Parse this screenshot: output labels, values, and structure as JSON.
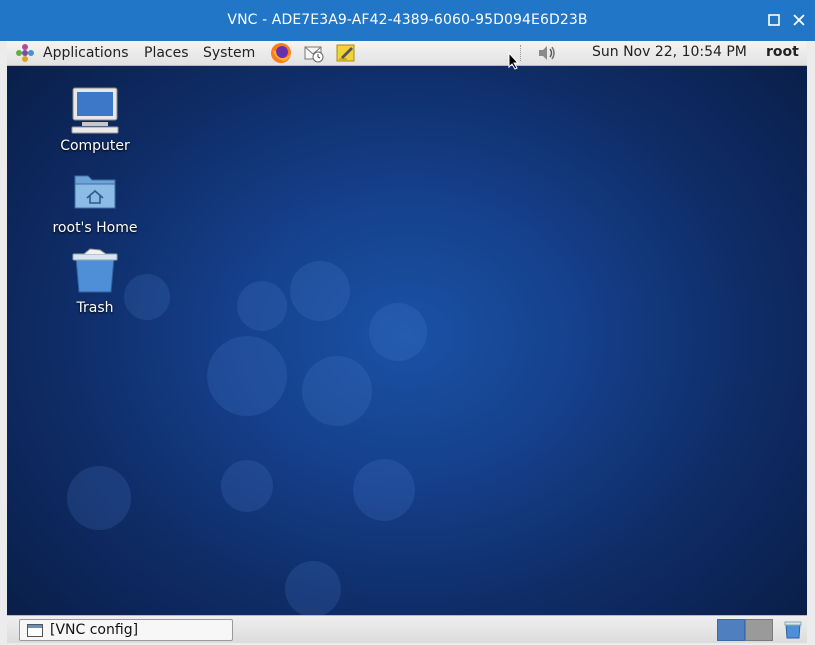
{
  "window": {
    "title": "VNC - ADE7E3A9-AF42-4389-6060-95D094E6D23B",
    "maximize_icon": "maximize-icon",
    "close_icon": "close-icon"
  },
  "top_panel": {
    "menus": {
      "applications": "Applications",
      "places": "Places",
      "system": "System"
    },
    "launchers": [
      "firefox-icon",
      "mail-clock-icon",
      "notes-icon"
    ],
    "volume_icon": "volume-icon",
    "clock": "Sun Nov 22, 10:54 PM",
    "user": "root"
  },
  "desktop": {
    "icons": [
      {
        "label": "Computer",
        "icon": "computer-icon"
      },
      {
        "label": "root's Home",
        "icon": "home-folder-icon"
      },
      {
        "label": "Trash",
        "icon": "trash-icon"
      }
    ]
  },
  "bottom_panel": {
    "tasks": [
      {
        "label": "[VNC config]",
        "icon": "window-icon"
      }
    ],
    "workspaces": [
      "workspace-1",
      "workspace-2"
    ],
    "trash_applet": "trash-applet-icon"
  },
  "colors": {
    "titlebar": "#2176c7",
    "desktop": "#153f8a"
  }
}
